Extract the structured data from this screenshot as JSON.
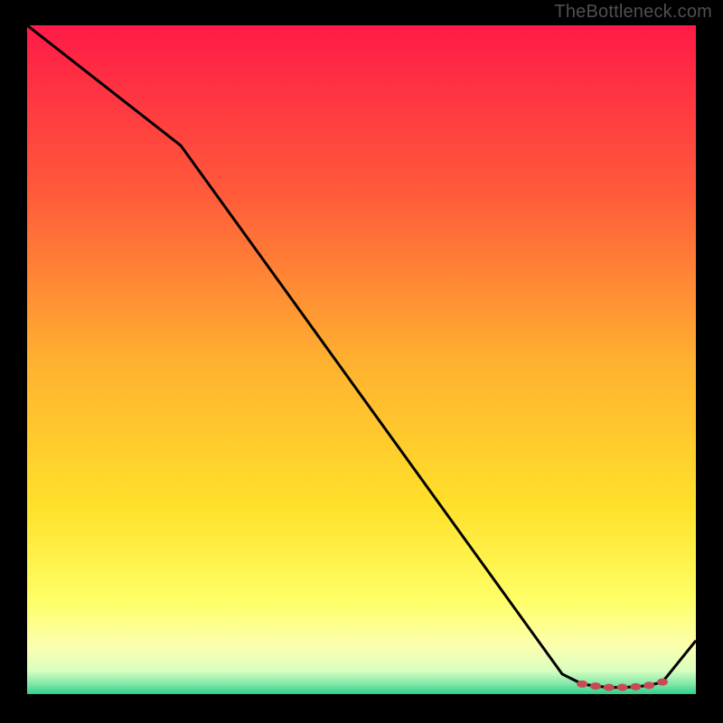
{
  "attribution": "TheBottleneck.com",
  "colors": {
    "background": "#000000",
    "line": "#000000",
    "marker": "#c94a55",
    "gradient_stops": [
      {
        "offset": 0.0,
        "color": "#ff1a47"
      },
      {
        "offset": 0.25,
        "color": "#ff5a3a"
      },
      {
        "offset": 0.5,
        "color": "#ffb030"
      },
      {
        "offset": 0.72,
        "color": "#ffe12a"
      },
      {
        "offset": 0.86,
        "color": "#ffff66"
      },
      {
        "offset": 0.93,
        "color": "#fbffb0"
      },
      {
        "offset": 0.965,
        "color": "#d8ffc0"
      },
      {
        "offset": 0.985,
        "color": "#7fe8a8"
      },
      {
        "offset": 1.0,
        "color": "#2fcf8a"
      }
    ]
  },
  "chart_data": {
    "type": "line",
    "title": "",
    "xlabel": "",
    "ylabel": "",
    "xlim": [
      0,
      100
    ],
    "ylim": [
      0,
      100
    ],
    "grid": false,
    "x": [
      0,
      23,
      80,
      83,
      85,
      87,
      89,
      91,
      93,
      95,
      100
    ],
    "values": [
      100,
      82,
      3,
      1.5,
      1.2,
      1.0,
      1.0,
      1.1,
      1.3,
      1.8,
      8
    ],
    "markers_index": [
      3,
      4,
      5,
      6,
      7,
      8,
      9
    ],
    "annotations": []
  }
}
